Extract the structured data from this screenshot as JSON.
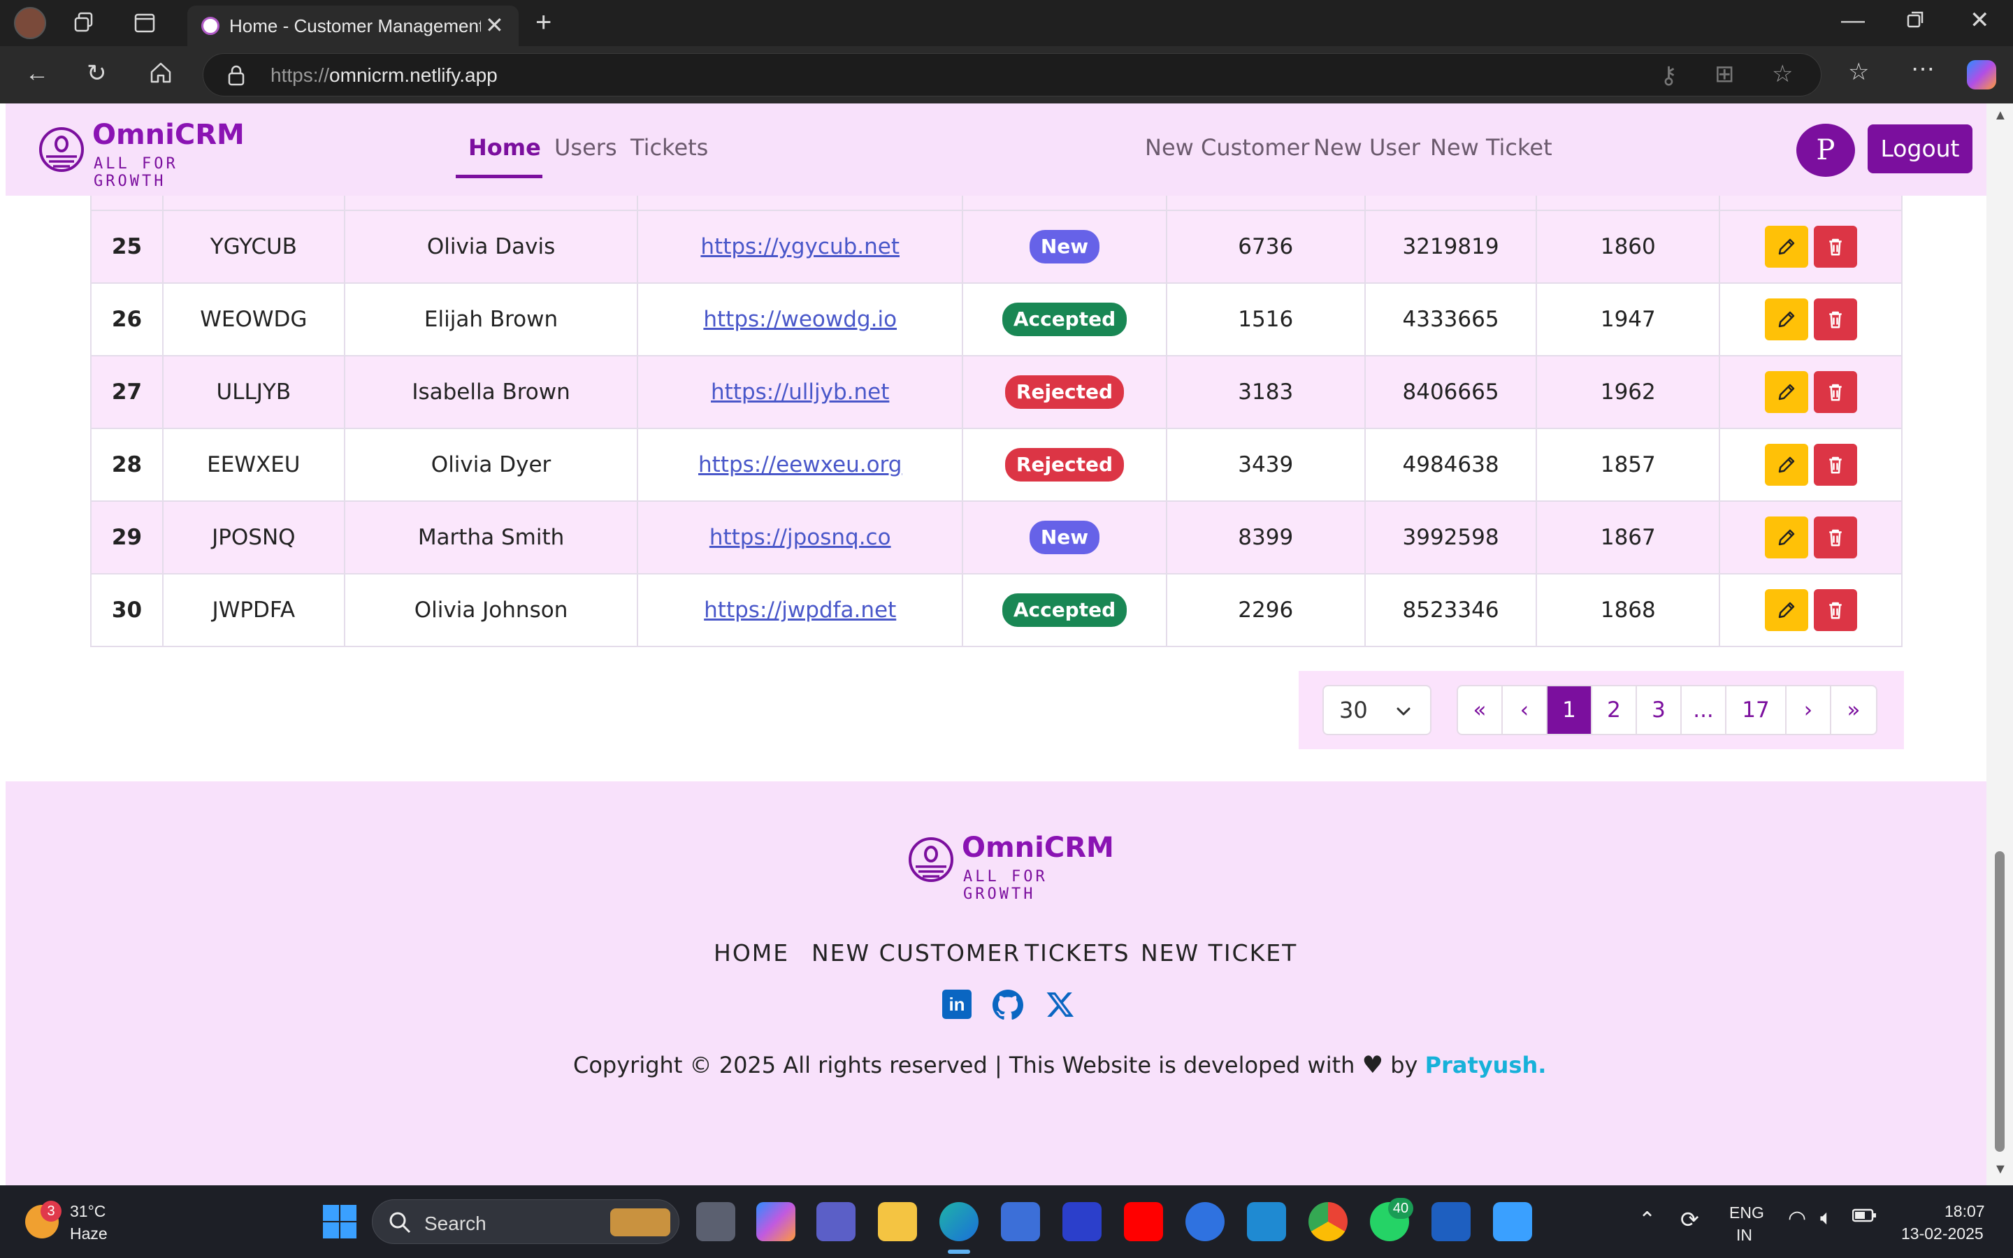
{
  "browser": {
    "tab_title": "Home - Customer Management |",
    "url_prefix": "https://",
    "url_host": "omnicrm.netlify.app"
  },
  "navbar": {
    "brand_name": "OmniCRM",
    "brand_tagline": "ALL FOR GROWTH",
    "links": [
      "Home",
      "Users",
      "Tickets"
    ],
    "actions": [
      "New Customer",
      "New User",
      "New Ticket"
    ],
    "avatar_initial": "P",
    "logout_label": "Logout"
  },
  "table": {
    "rows": [
      {
        "id": "25",
        "code": "YGYCUB",
        "name": "Olivia Davis",
        "website": "https://ygycub.net",
        "status": "New",
        "col5": "6736",
        "col6": "3219819",
        "col7": "1860"
      },
      {
        "id": "26",
        "code": "WEOWDG",
        "name": "Elijah Brown",
        "website": "https://weowdg.io",
        "status": "Accepted",
        "col5": "1516",
        "col6": "4333665",
        "col7": "1947"
      },
      {
        "id": "27",
        "code": "ULLJYB",
        "name": "Isabella Brown",
        "website": "https://ulljyb.net",
        "status": "Rejected",
        "col5": "3183",
        "col6": "8406665",
        "col7": "1962"
      },
      {
        "id": "28",
        "code": "EEWXEU",
        "name": "Olivia Dyer",
        "website": "https://eewxeu.org",
        "status": "Rejected",
        "col5": "3439",
        "col6": "4984638",
        "col7": "1857"
      },
      {
        "id": "29",
        "code": "JPOSNQ",
        "name": "Martha Smith",
        "website": "https://jposnq.co",
        "status": "New",
        "col5": "8399",
        "col6": "3992598",
        "col7": "1867"
      },
      {
        "id": "30",
        "code": "JWPDFA",
        "name": "Olivia Johnson",
        "website": "https://jwpdfa.net",
        "status": "Accepted",
        "col5": "2296",
        "col6": "8523346",
        "col7": "1868"
      }
    ]
  },
  "pagination": {
    "page_size": "30",
    "first": "«",
    "prev": "‹",
    "pages": [
      "1",
      "2",
      "3",
      "...",
      "17"
    ],
    "next": "›",
    "last": "»"
  },
  "footer": {
    "brand_name": "OmniCRM",
    "brand_tagline": "ALL FOR GROWTH",
    "links": [
      "HOME",
      "NEW CUSTOMER",
      "TICKETS",
      "NEW TICKET"
    ],
    "social": [
      "linkedin-icon",
      "github-icon",
      "x-icon"
    ],
    "copyright_text": "Copyright © 2025 All rights reserved | This Website is developed with",
    "by_text": "by",
    "author": "Pratyush."
  },
  "taskbar": {
    "weather_badge": "3",
    "temperature": "31°C",
    "weather": "Haze",
    "search_placeholder": "Search",
    "whatsapp_badge": "40",
    "lang_top": "ENG",
    "lang_bottom": "IN",
    "time": "18:07",
    "date": "13-02-2025"
  },
  "colors": {
    "brand": "#7b0f9e",
    "nav_bg": "#f8e1fb",
    "new": "#6662e8",
    "accepted": "#198754",
    "rejected": "#dc3545",
    "edit": "#ffc107",
    "author": "#17b1d9"
  }
}
